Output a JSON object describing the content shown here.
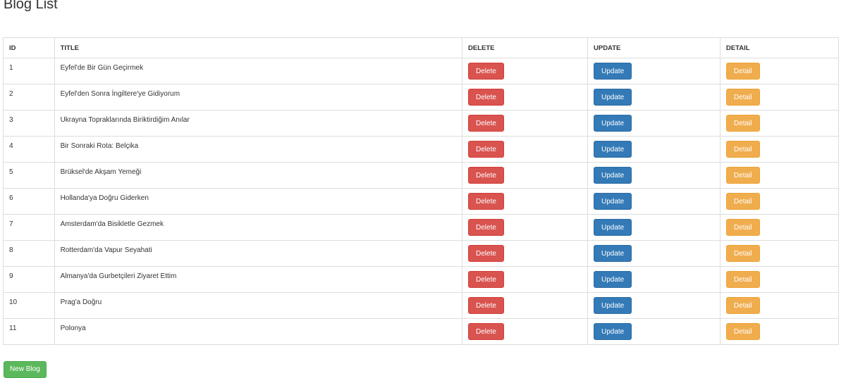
{
  "page": {
    "title": "Blog List"
  },
  "table": {
    "headers": {
      "id": "ID",
      "title": "TITLE",
      "delete": "DELETE",
      "update": "UPDATE",
      "detail": "DETAIL"
    },
    "rows": [
      {
        "id": "1",
        "title": "Eyfel'de Bir Gün Geçirmek"
      },
      {
        "id": "2",
        "title": "Eyfel'den Sonra İngiltere'ye Gidiyorum"
      },
      {
        "id": "3",
        "title": "Ukrayna Topraklarında Biriktirdiğim Anılar"
      },
      {
        "id": "4",
        "title": "Bir Sonraki Rota: Belçika"
      },
      {
        "id": "5",
        "title": "Brüksel'de Akşam Yemeği"
      },
      {
        "id": "6",
        "title": "Hollanda'ya Doğru Giderken"
      },
      {
        "id": "7",
        "title": "Amsterdam'da Bisikletle Gezmek"
      },
      {
        "id": "8",
        "title": "Rotterdam'da Vapur Seyahati"
      },
      {
        "id": "9",
        "title": "Almanya'da Gurbetçileri Ziyaret Ettim"
      },
      {
        "id": "10",
        "title": "Prag'a Doğru"
      },
      {
        "id": "11",
        "title": "Polonya"
      }
    ],
    "buttons": {
      "delete": "Delete",
      "update": "Update",
      "detail": "Detail"
    }
  },
  "actions": {
    "new_blog": "New Blog"
  },
  "colors": {
    "delete": "#d9534f",
    "update": "#337ab7",
    "detail": "#f0ad4e",
    "new": "#5cb85c"
  }
}
